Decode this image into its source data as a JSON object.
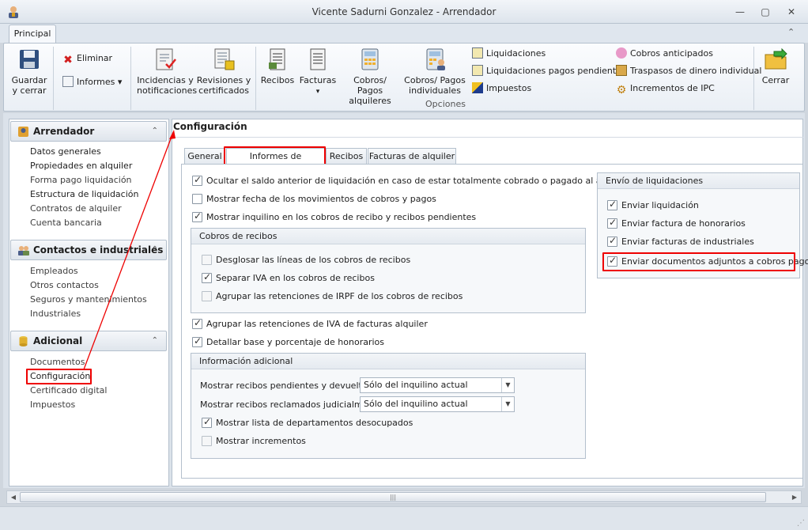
{
  "window": {
    "title": "Vicente Sadurni Gonzalez - Arrendador",
    "minimize": "—",
    "maximize": "▢",
    "close": "✕"
  },
  "ribbon": {
    "tab": "Principal",
    "collapse": "⌃",
    "buttons": {
      "guardar": "Guardar y cerrar",
      "eliminar": "Eliminar",
      "informes": "Informes ▾",
      "incidencias": "Incidencias y notificaciones",
      "revisiones": "Revisiones y certificados",
      "recibos": "Recibos",
      "facturas": "Facturas",
      "facturas_arrow": "▾",
      "cobros_alquileres": "Cobros/ Pagos alquileres",
      "cobros_individuales": "Cobros/ Pagos individuales",
      "liquidaciones": "Liquidaciones",
      "liquidaciones_pendientes": "Liquidaciones pagos pendientes",
      "impuestos": "Impuestos",
      "cobros_anticipados": "Cobros anticipados",
      "traspasos": "Traspasos de dinero individual",
      "incrementos": "Incrementos de IPC",
      "cerrar": "Cerrar"
    },
    "group_label": "Opciones"
  },
  "sidebar": {
    "sections": [
      {
        "title": "Arrendador",
        "chevron": "⌃",
        "items": [
          "Datos generales",
          "Propiedades en alquiler",
          "Forma pago liquidación",
          "Estructura de liquidación",
          "Contratos de alquiler",
          "Cuenta bancaria"
        ]
      },
      {
        "title": "Contactos e industriales",
        "chevron": "⌃",
        "items": [
          "Empleados",
          "Otros contactos",
          "Seguros y mantenimientos",
          "Industriales"
        ]
      },
      {
        "title": "Adicional",
        "chevron": "⌃",
        "items": [
          "Documentos",
          "Configuración",
          "Certificado digital",
          "Impuestos"
        ]
      }
    ]
  },
  "content": {
    "title": "Configuración",
    "tabs": [
      "General",
      "Informes de liquidación",
      "Recibos",
      "Facturas de alquiler"
    ],
    "options": {
      "ocultar_saldo": "Ocultar el saldo anterior de liquidación en caso de estar totalmente cobrado o pagado al arrendador",
      "mostrar_fecha": "Mostrar fecha de los movimientos de cobros y pagos",
      "mostrar_inquilino": "Mostrar inquilino en los cobros de recibo y recibos pendientes",
      "agrupar_iva": "Agrupar las retenciones de IVA de facturas alquiler",
      "detallar_base": "Detallar base y porcentaje de honorarios"
    },
    "cobros_recibos": {
      "title": "Cobros de recibos",
      "desglosar": "Desglosar las líneas de los cobros de recibos",
      "separar_iva": "Separar IVA en los cobros de recibos",
      "agrupar_irpf": "Agrupar las retenciones de IRPF de los cobros de recibos"
    },
    "info_adicional": {
      "title": "Información adicional",
      "pendientes_label": "Mostrar recibos pendientes y devueltos:",
      "pendientes_value": "Sólo del inquilino actual",
      "reclamados_label": "Mostrar recibos reclamados judicialmente:",
      "reclamados_value": "Sólo del inquilino actual",
      "departamentos": "Mostrar lista de departamentos desocupados",
      "incrementos": "Mostrar incrementos",
      "dropdown_arrow": "▼"
    },
    "envio": {
      "title": "Envío de liquidaciones",
      "enviar_liquidacion": "Enviar liquidación",
      "enviar_honorarios": "Enviar factura de honorarios",
      "enviar_industriales": "Enviar facturas de industriales",
      "enviar_adjuntos": "Enviar documentos adjuntos a cobros pagos"
    }
  },
  "scrollbar": {
    "left": "◀",
    "right": "▶",
    "grip": "|||"
  },
  "statusbar": {
    "grip": "⋰"
  },
  "colors": {
    "accent_red": "#e00000",
    "ribbon_bg": "#eaeff5",
    "border": "#b4c0cd"
  }
}
